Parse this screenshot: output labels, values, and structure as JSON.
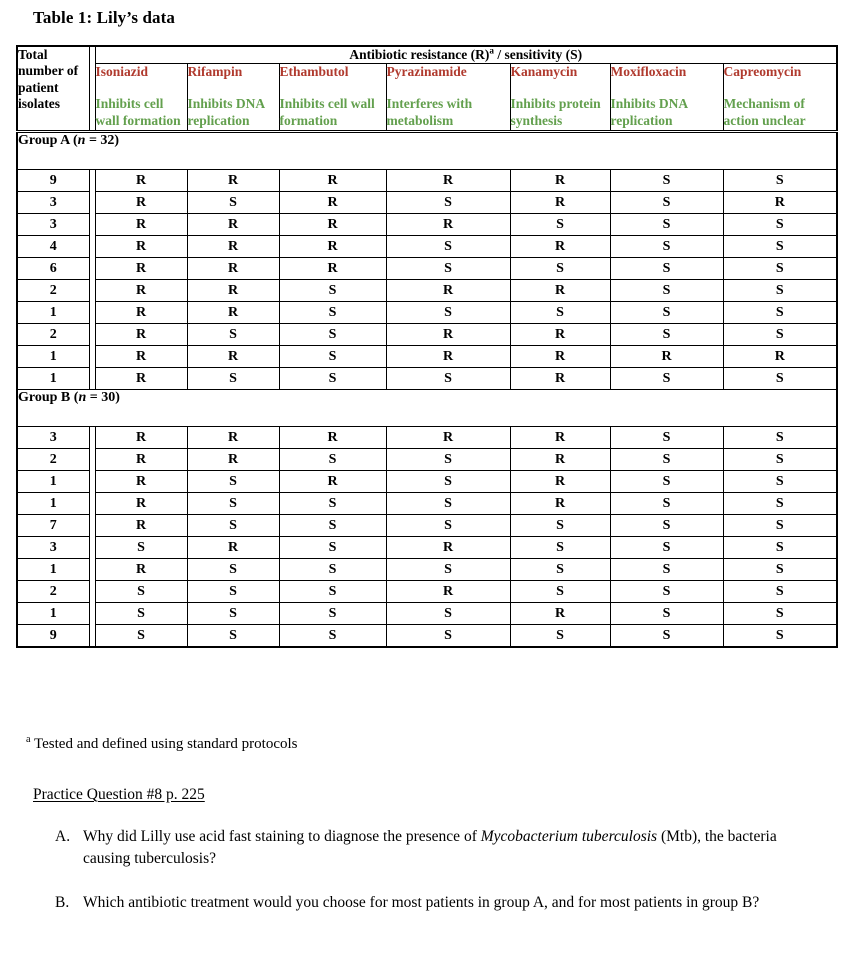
{
  "title": "Table 1: Lily’s data",
  "colors": {
    "drug_name": "#B03A2E",
    "mechanism": "#63A04E",
    "text": "#000000",
    "border": "#000000"
  },
  "table": {
    "count_header": "Total number of patient isolates",
    "span_header_prefix": "Antibiotic resistance (R)",
    "span_header_sup": "a",
    "span_header_suffix": " / sensitivity (S)",
    "columns": [
      {
        "name": "Isoniazid",
        "mechanism": "Inhibits cell wall formation"
      },
      {
        "name": "Rifampin",
        "mechanism": "Inhibits DNA replication"
      },
      {
        "name": "Ethambutol",
        "mechanism": "Inhibits cell wall formation"
      },
      {
        "name": "Pyrazinamide",
        "mechanism": "Interferes with metabolism"
      },
      {
        "name": "Kanamycin",
        "mechanism": "Inhibits protein synthesis"
      },
      {
        "name": "Moxifloxacin",
        "mechanism": "Inhibits DNA replication"
      },
      {
        "name": "Capreomycin",
        "mechanism": "Mechanism of action unclear"
      }
    ],
    "groups": [
      {
        "label_prefix": "Group A (",
        "label_italic": "n",
        "label_suffix": " = 32)",
        "label_full": "Group A (n = 32)",
        "rows": [
          {
            "count": "9",
            "values": [
              "R",
              "R",
              "R",
              "R",
              "R",
              "S",
              "S"
            ]
          },
          {
            "count": "3",
            "values": [
              "R",
              "S",
              "R",
              "S",
              "R",
              "S",
              "R"
            ]
          },
          {
            "count": "3",
            "values": [
              "R",
              "R",
              "R",
              "R",
              "S",
              "S",
              "S"
            ]
          },
          {
            "count": "4",
            "values": [
              "R",
              "R",
              "R",
              "S",
              "R",
              "S",
              "S"
            ]
          },
          {
            "count": "6",
            "values": [
              "R",
              "R",
              "R",
              "S",
              "S",
              "S",
              "S"
            ]
          },
          {
            "count": "2",
            "values": [
              "R",
              "R",
              "S",
              "R",
              "R",
              "S",
              "S"
            ]
          },
          {
            "count": "1",
            "values": [
              "R",
              "R",
              "S",
              "S",
              "S",
              "S",
              "S"
            ]
          },
          {
            "count": "2",
            "values": [
              "R",
              "S",
              "S",
              "R",
              "R",
              "S",
              "S"
            ]
          },
          {
            "count": "1",
            "values": [
              "R",
              "R",
              "S",
              "R",
              "R",
              "R",
              "R"
            ]
          },
          {
            "count": "1",
            "values": [
              "R",
              "S",
              "S",
              "S",
              "R",
              "S",
              "S"
            ]
          }
        ]
      },
      {
        "label_prefix": "Group B (",
        "label_italic": "n",
        "label_suffix": " = 30)",
        "label_full": "Group B (n = 30)",
        "rows": [
          {
            "count": "3",
            "values": [
              "R",
              "R",
              "R",
              "R",
              "R",
              "S",
              "S"
            ]
          },
          {
            "count": "2",
            "values": [
              "R",
              "R",
              "S",
              "S",
              "R",
              "S",
              "S"
            ]
          },
          {
            "count": "1",
            "values": [
              "R",
              "S",
              "R",
              "S",
              "R",
              "S",
              "S"
            ]
          },
          {
            "count": "1",
            "values": [
              "R",
              "S",
              "S",
              "S",
              "R",
              "S",
              "S"
            ]
          },
          {
            "count": "7",
            "values": [
              "R",
              "S",
              "S",
              "S",
              "S",
              "S",
              "S"
            ]
          },
          {
            "count": "3",
            "values": [
              "S",
              "R",
              "S",
              "R",
              "S",
              "S",
              "S"
            ]
          },
          {
            "count": "1",
            "values": [
              "R",
              "S",
              "S",
              "S",
              "S",
              "S",
              "S"
            ]
          },
          {
            "count": "2",
            "values": [
              "S",
              "S",
              "S",
              "R",
              "S",
              "S",
              "S"
            ]
          },
          {
            "count": "1",
            "values": [
              "S",
              "S",
              "S",
              "S",
              "R",
              "S",
              "S"
            ]
          },
          {
            "count": "9",
            "values": [
              "S",
              "S",
              "S",
              "S",
              "S",
              "S",
              "S"
            ]
          }
        ]
      }
    ]
  },
  "footnote": {
    "marker": "a",
    "text": " Tested and defined using standard protocols"
  },
  "questions": {
    "heading": "Practice Question #8 p. 225",
    "items": [
      {
        "marker": "A.",
        "text_before_italic": "Why did Lilly use acid fast staining to diagnose the presence of ",
        "italic_text": "Mycobacterium tuberculosis",
        "text_after_italic": " (Mtb), the bacteria causing tuberculosis?"
      },
      {
        "marker": "B.",
        "text_before_italic": "Which antibiotic treatment would you choose for most patients in group A, and for most patients in group B?",
        "italic_text": "",
        "text_after_italic": ""
      }
    ]
  }
}
